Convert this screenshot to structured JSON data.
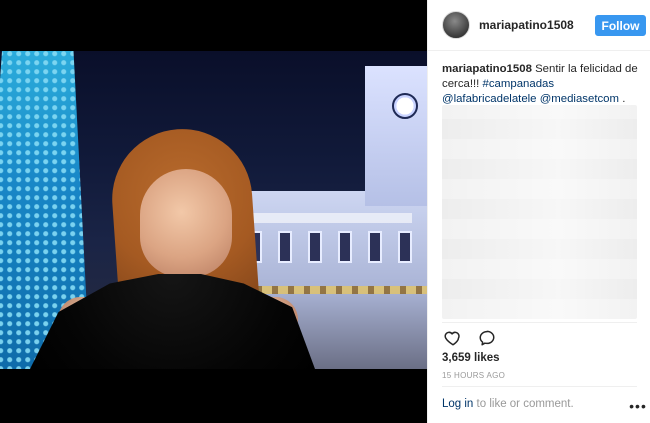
{
  "post": {
    "username": "mariapatino1508",
    "follow_label": "Follow",
    "caption": {
      "username": "mariapatino1508",
      "text": "Sentir la felicidad de cerca!!!",
      "hashtag": "#campanadas",
      "mention_1": "@lafabricadelatele",
      "mention_2": "@mediasetcom",
      "trailing": "."
    },
    "likes_label": "3,659 likes",
    "time_label": "15 HOURS AGO",
    "comment": {
      "login_label": "Log in",
      "rest_label": "to like or comment.",
      "more_label": "•••"
    }
  },
  "icons": {
    "like": "heart-icon",
    "comment": "comment-bubble-icon",
    "more": "more-horizontal-icon"
  },
  "colors": {
    "follow_button": "#3897f0",
    "link": "#003569",
    "muted": "#999999",
    "text": "#262626",
    "divider": "#efefef"
  }
}
